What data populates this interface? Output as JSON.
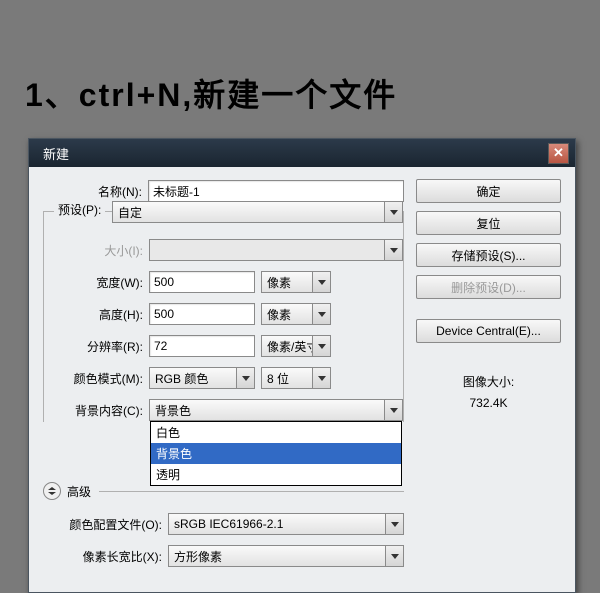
{
  "tutorial": "1、ctrl+N,新建一个文件",
  "dialog": {
    "title": "新建",
    "name_label": "名称(N):",
    "name_value": "未标题-1",
    "preset_label": "预设(P):",
    "preset_value": "自定",
    "size_label": "大小(I):",
    "width_label": "宽度(W):",
    "width_value": "500",
    "width_unit": "像素",
    "height_label": "高度(H):",
    "height_value": "500",
    "height_unit": "像素",
    "res_label": "分辨率(R):",
    "res_value": "72",
    "res_unit": "像素/英寸",
    "mode_label": "颜色模式(M):",
    "mode_value": "RGB 颜色",
    "mode_bits": "8 位",
    "bg_label": "背景内容(C):",
    "bg_value": "背景色",
    "bg_options": [
      "白色",
      "背景色",
      "透明"
    ],
    "adv_label": "高级",
    "profile_label": "颜色配置文件(O):",
    "profile_value": "sRGB IEC61966-2.1",
    "aspect_label": "像素长宽比(X):",
    "aspect_value": "方形像素",
    "ok": "确定",
    "reset": "复位",
    "save_preset": "存储预设(S)...",
    "del_preset": "删除预设(D)...",
    "device_central": "Device Central(E)...",
    "size_info_label": "图像大小:",
    "size_info_value": "732.4K"
  }
}
